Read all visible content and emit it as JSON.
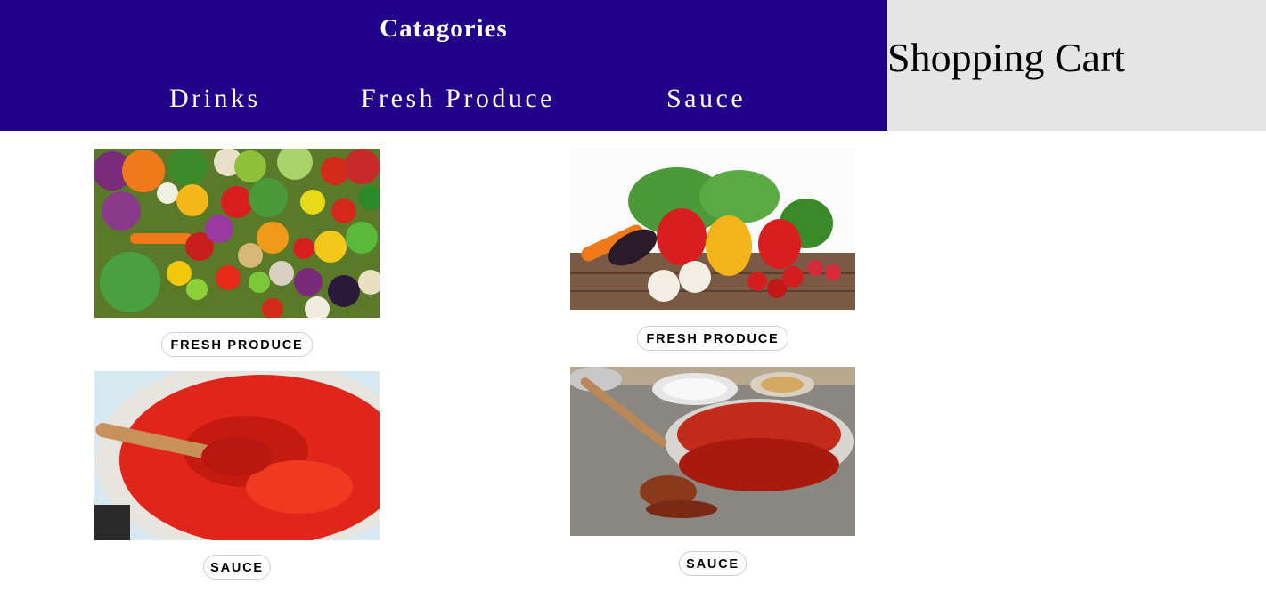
{
  "header": {
    "categories_title": "Catagories",
    "nav": [
      {
        "label": "Drinks"
      },
      {
        "label": "Fresh Produce"
      },
      {
        "label": "Sauce"
      }
    ]
  },
  "cart": {
    "title": "Shopping Cart"
  },
  "products": [
    {
      "label": "FRESH PRODUCE",
      "image": "assorted-vegetables-photo"
    },
    {
      "label": "FRESH PRODUCE",
      "image": "vegetables-on-wooden-table-photo"
    },
    {
      "label": "SAUCE",
      "image": "tomato-sauce-pot-photo"
    },
    {
      "label": "SAUCE",
      "image": "sauce-bowl-and-spoon-photo"
    }
  ],
  "colors": {
    "header_bg": "#21008a",
    "cart_bg": "#e5e5e5",
    "pill_border": "#cfcfcf"
  }
}
